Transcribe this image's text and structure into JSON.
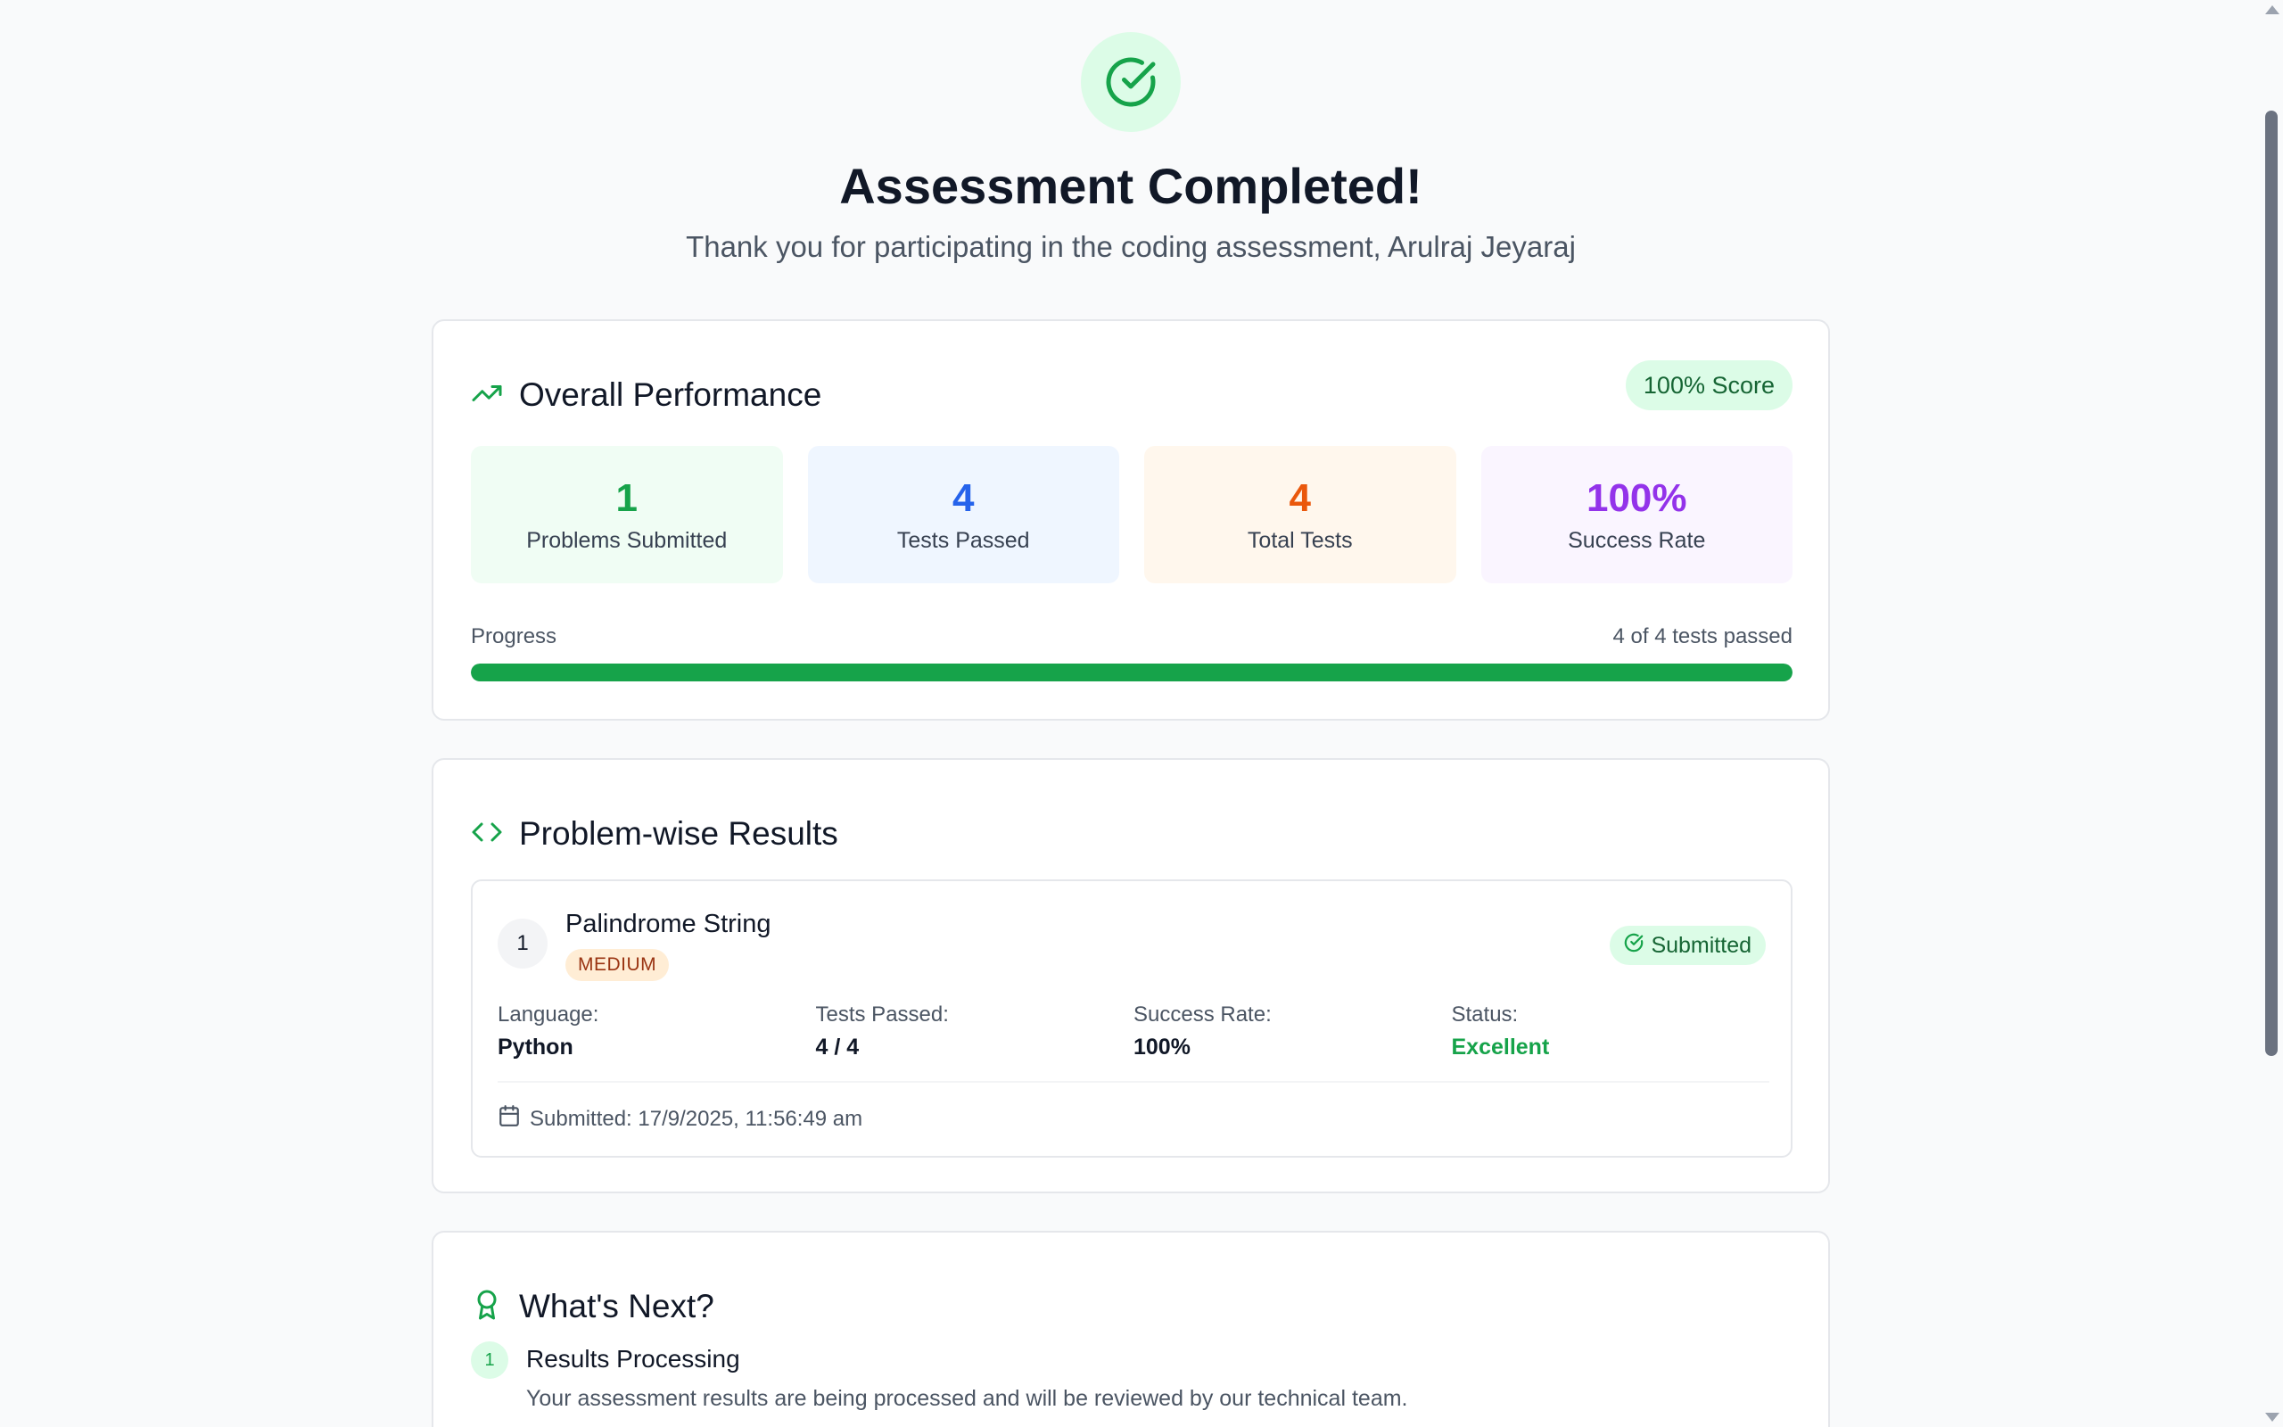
{
  "header": {
    "icon": "check-circle-icon",
    "title": "Assessment Completed!",
    "subtitle": "Thank you for participating in the coding assessment, Arulraj Jeyaraj"
  },
  "performance": {
    "icon": "trending-up-icon",
    "title": "Overall Performance",
    "score_badge": "100% Score",
    "stats": [
      {
        "value": "1",
        "label": "Problems Submitted",
        "color": "#16a34a"
      },
      {
        "value": "4",
        "label": "Tests Passed",
        "color": "#2563eb"
      },
      {
        "value": "4",
        "label": "Total Tests",
        "color": "#ea580c"
      },
      {
        "value": "100%",
        "label": "Success Rate",
        "color": "#9333ea"
      }
    ],
    "progress_label": "Progress",
    "progress_summary": "4 of 4 tests passed",
    "progress_fraction": 1.0,
    "progress_color": "#16a34a"
  },
  "problems": {
    "icon": "code-icon",
    "title": "Problem-wise Results",
    "items": [
      {
        "number": "1",
        "title": "Palindrome String",
        "difficulty": "MEDIUM",
        "status_badge": "Submitted",
        "status_badge_icon": "check-circle-icon",
        "language_label": "Language:",
        "language": "Python",
        "tests_label": "Tests Passed:",
        "tests": "4 / 4",
        "success_label": "Success Rate:",
        "success": "100%",
        "status_label": "Status:",
        "status": "Excellent",
        "submitted_icon": "calendar-icon",
        "submitted_at": "Submitted: 17/9/2025, 11:56:49 am"
      }
    ]
  },
  "next": {
    "icon": "award-icon",
    "title": "What's Next?",
    "steps": [
      {
        "number": "1",
        "title": "Results Processing",
        "description": "Your assessment results are being processed and will be reviewed by our technical team."
      }
    ]
  }
}
